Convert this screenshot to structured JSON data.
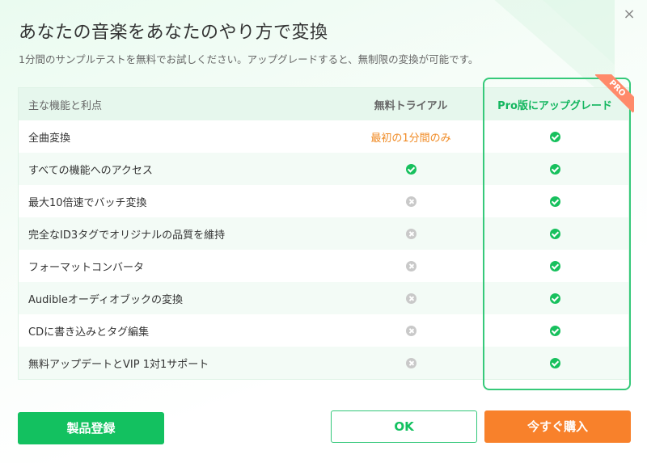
{
  "dialog": {
    "title": "あなたの音楽をあなたのやり方で変換",
    "subtitle": "1分間のサンプルテストを無料でお試しください。アップグレードすると、無制限の変換が可能です。",
    "close_label": "×"
  },
  "table": {
    "headers": [
      "主な機能と利点",
      "無料トライアル",
      "Pro版にアップグレード"
    ],
    "rows": [
      {
        "feature": "全曲変換",
        "free": "最初の1分間のみ",
        "free_status": "text",
        "pro_status": "check"
      },
      {
        "feature": "すべての機能へのアクセス",
        "free_status": "check",
        "pro_status": "check"
      },
      {
        "feature": "最大10倍速でバッチ変換",
        "free_status": "cross",
        "pro_status": "check"
      },
      {
        "feature": "完全なID3タグでオリジナルの品質を維持",
        "free_status": "cross",
        "pro_status": "check"
      },
      {
        "feature": "フォーマットコンバータ",
        "free_status": "cross",
        "pro_status": "check"
      },
      {
        "feature": "Audibleオーディオブックの変換",
        "free_status": "cross",
        "pro_status": "check"
      },
      {
        "feature": "CDに書き込みとタグ編集",
        "free_status": "cross",
        "pro_status": "check"
      },
      {
        "feature": "無料アップデートとVIP 1対1サポート",
        "free_status": "cross",
        "pro_status": "check"
      }
    ]
  },
  "badge": {
    "pro_label": "PRO"
  },
  "buttons": {
    "register": "製品登録",
    "ok": "OK",
    "buy": "今すぐ購入"
  },
  "colors": {
    "accent_green": "#13c160",
    "accent_orange": "#f8812b",
    "free_text_orange": "#f08a24",
    "ribbon": "#ff8a6a"
  },
  "icons": {
    "check": "check-circle-icon",
    "cross": "x-circle-icon",
    "close": "close-icon"
  }
}
